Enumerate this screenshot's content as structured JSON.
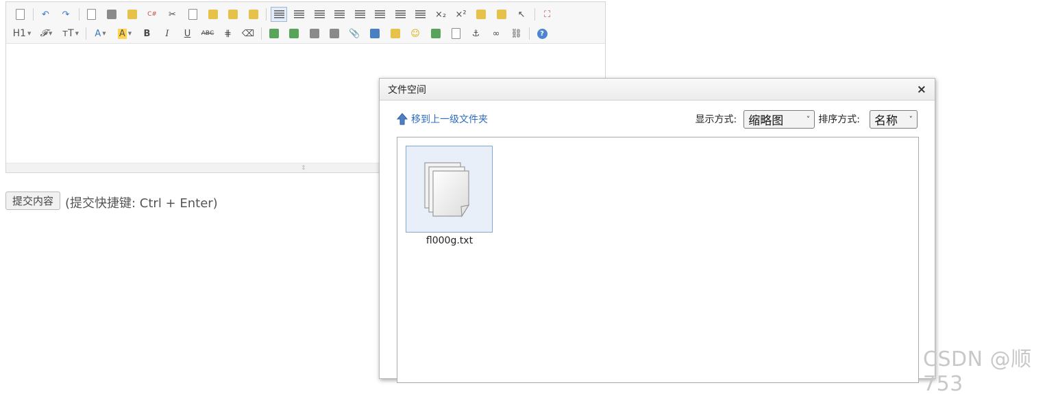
{
  "editor": {
    "toolbar_row1": [
      "source-icon",
      "undo-icon",
      "redo-icon",
      "preview-icon",
      "print-icon",
      "template-icon",
      "code-icon",
      "cut-icon",
      "copy-icon",
      "paste-icon",
      "paste-text-icon",
      "paste-word-icon",
      "align-left-icon",
      "align-center-icon",
      "align-right-icon",
      "align-justify-icon",
      "ordered-list-icon",
      "unordered-list-icon",
      "indent-icon",
      "outdent-icon",
      "subscript-icon",
      "superscript-icon",
      "clear-format-icon",
      "select-all-icon",
      "pointer-icon",
      "fullscreen-icon"
    ],
    "toolbar_row2": {
      "heading_label": "H1",
      "font_label": "𝓕",
      "size_label": "ᴛT",
      "font_color_label": "A",
      "highlight_label": "A",
      "bold_label": "B",
      "italic_label": "I",
      "underline_label": "U",
      "strike_label": "ABC"
    }
  },
  "submit": {
    "button_label": "提交内容",
    "hint": "(提交快捷键: Ctrl + Enter)"
  },
  "dialog": {
    "title": "文件空间",
    "close_label": "×",
    "up_folder_label": "移到上一级文件夹",
    "view_mode_label": "显示方式:",
    "view_mode_value": "缩略图",
    "sort_label": "排序方式:",
    "sort_value": "名称",
    "files": [
      {
        "name": "fl000g.txt"
      }
    ]
  },
  "watermark": "CSDN @顺753",
  "colors": {
    "accent_blue": "#2d6cc0",
    "selection_bg": "#e8eff8",
    "selection_border": "#7fa8d9"
  }
}
